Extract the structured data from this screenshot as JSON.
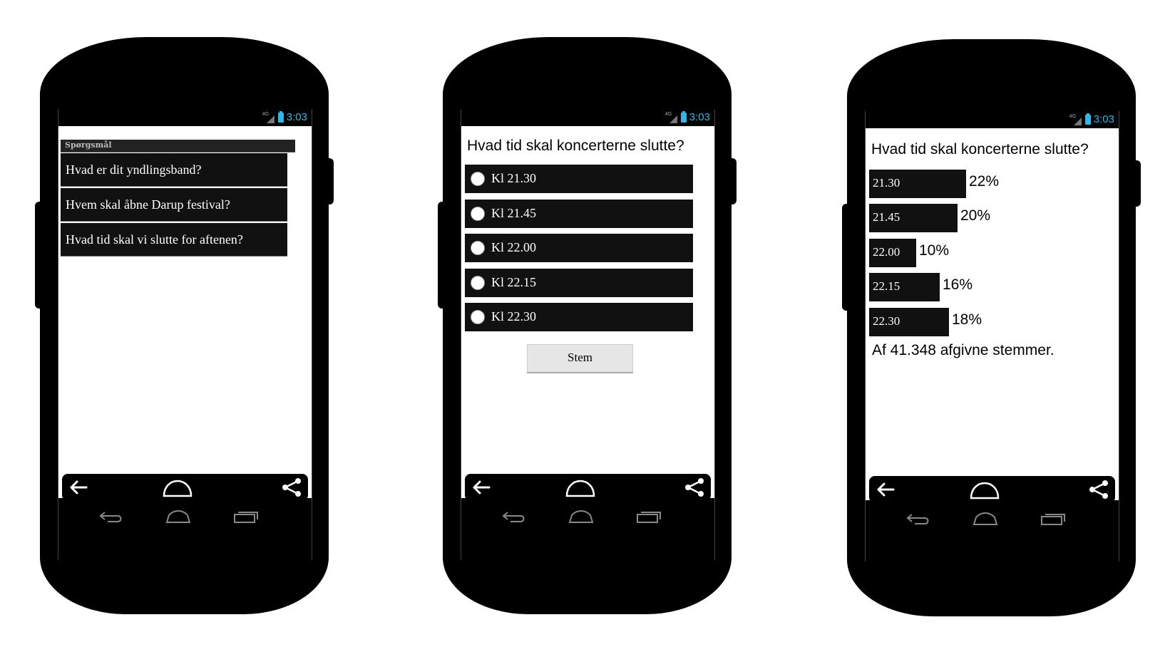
{
  "status": {
    "network": "4G",
    "time": "3:03"
  },
  "list_screen": {
    "header": "Spørgsmål",
    "items": [
      "Hvad er dit yndlingsband?",
      "Hvem skal åbne Darup festival?",
      "Hvad tid skal vi slutte for aftenen?"
    ]
  },
  "poll_screen": {
    "question": "Hvad tid skal koncerterne slutte?",
    "options": [
      "Kl 21.30",
      "Kl 21.45",
      "Kl 22.00",
      "Kl 22.15",
      "Kl 22.30"
    ],
    "vote_button": "Stem"
  },
  "results_screen": {
    "question": "Hvad tid skal koncerterne slutte?",
    "results": [
      {
        "label": "21.30",
        "percent": 22,
        "percent_text": "22%"
      },
      {
        "label": "21.45",
        "percent": 20,
        "percent_text": "20%"
      },
      {
        "label": "22.00",
        "percent": 10,
        "percent_text": "10%"
      },
      {
        "label": "22.15",
        "percent": 16,
        "percent_text": "16%"
      },
      {
        "label": "22.30",
        "percent": 18,
        "percent_text": "18%"
      }
    ],
    "total_text": "Af 41.348 afgivne stemmer."
  },
  "icons": {
    "app_nav": [
      "back-arrow-icon",
      "home-icon",
      "share-icon"
    ],
    "system_nav": [
      "system-back-icon",
      "system-home-icon",
      "system-recent-apps-icon"
    ],
    "status": [
      "network-signal-icon",
      "battery-icon"
    ]
  },
  "colors": {
    "accent": "#33b5e5",
    "item_bg": "#111111",
    "screen_bg": "#ffffff"
  }
}
